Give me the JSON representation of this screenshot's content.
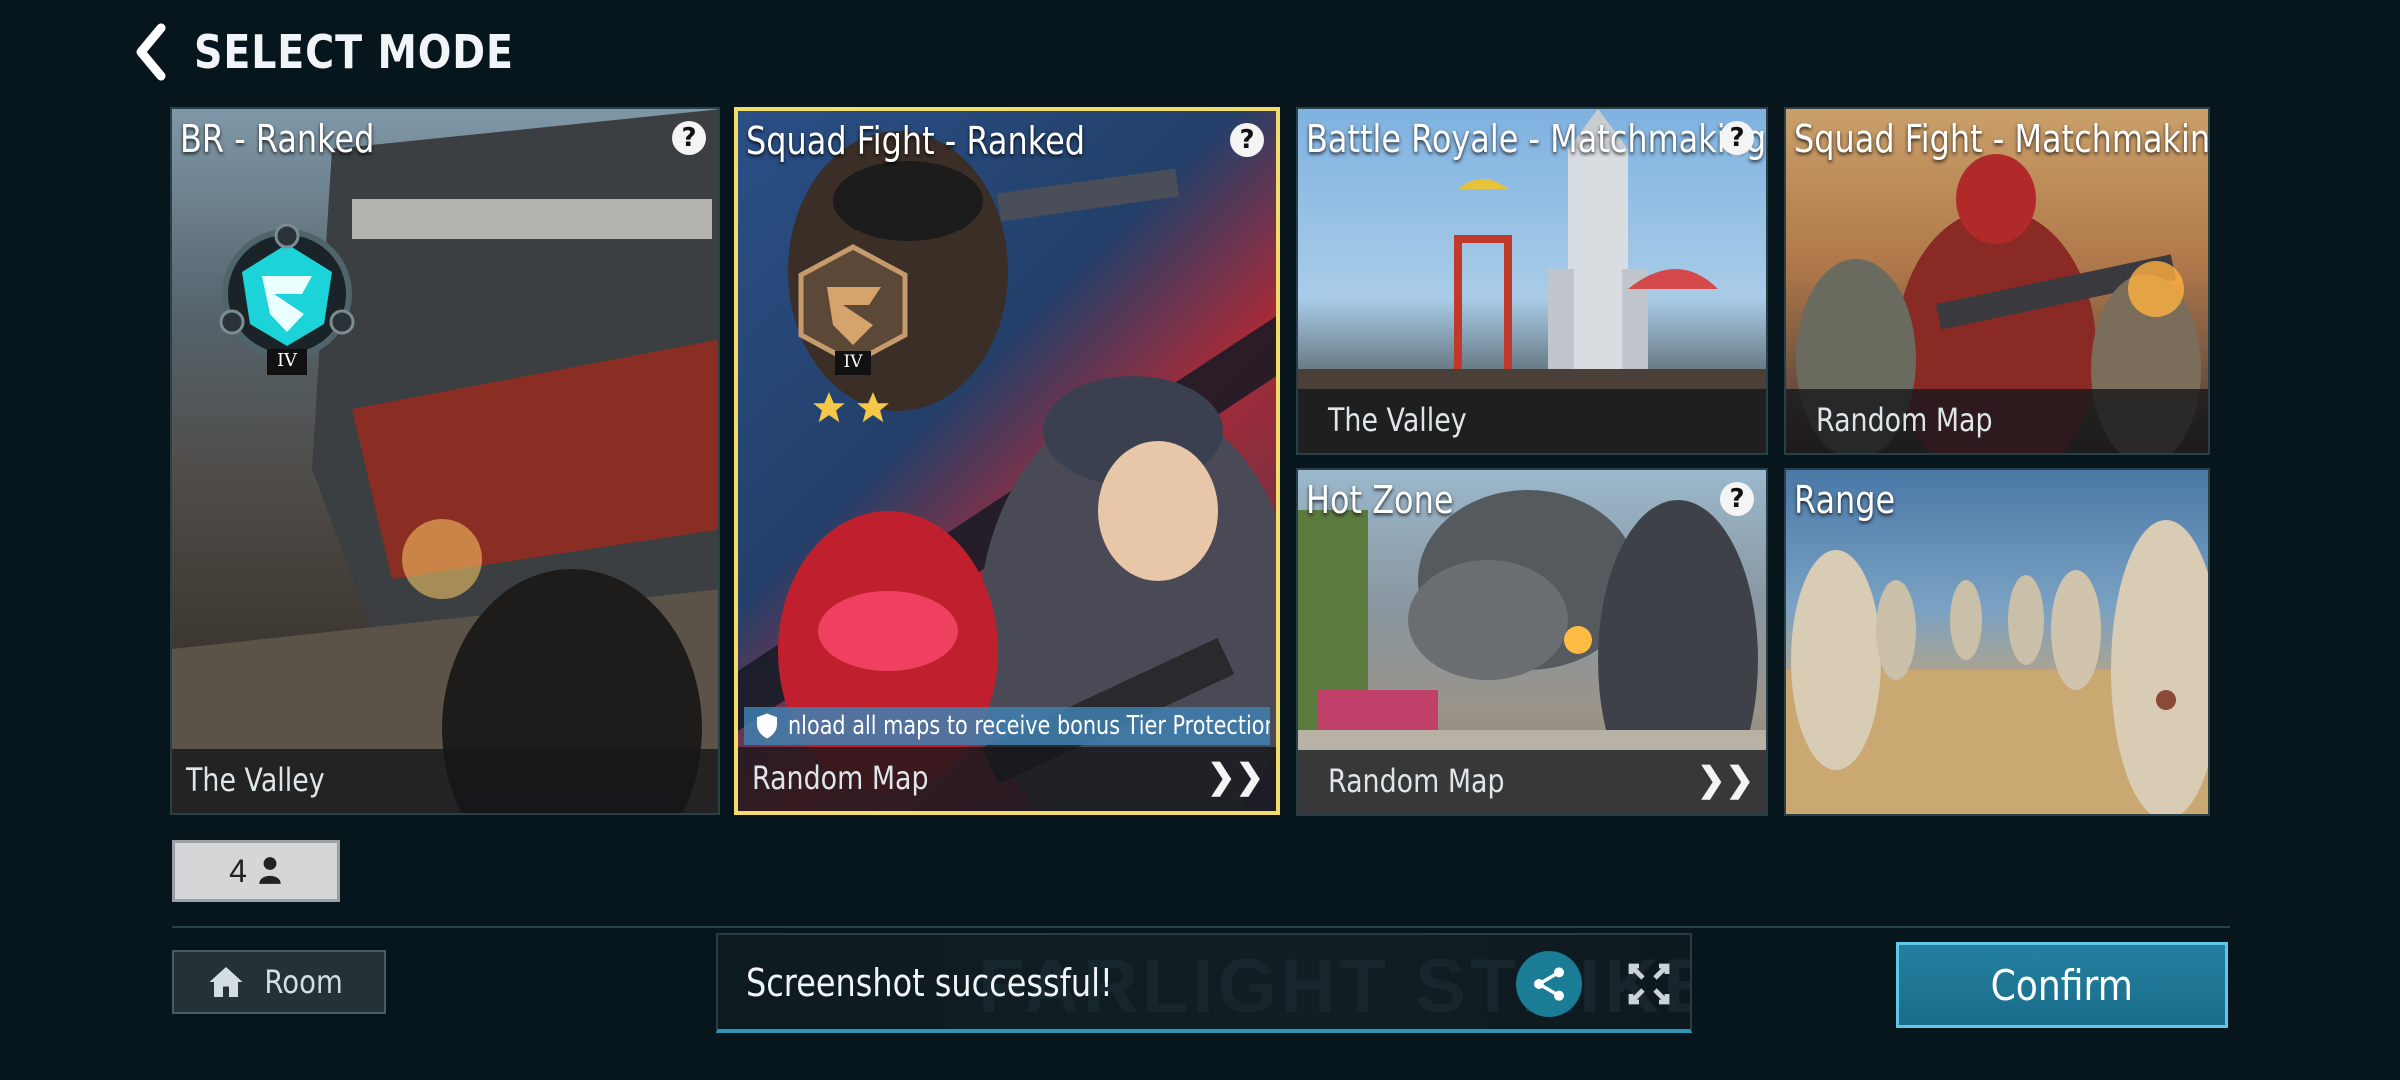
{
  "header": {
    "title": "SELECT MODE",
    "back_icon": "chevron-left-icon"
  },
  "modes": [
    {
      "id": "br-ranked",
      "name": "BR - Ranked",
      "map": "The Valley",
      "has_help": true,
      "rank_tier": "IV",
      "selected": false
    },
    {
      "id": "squad-ranked",
      "name": "Squad Fight - Ranked",
      "map": "Random Map",
      "has_help": true,
      "rank_tier": "IV",
      "stars": 2,
      "notice": "nload all maps to receive bonus Tier Protection Points",
      "selected": true
    },
    {
      "id": "br-matchmaking",
      "name": "Battle Royale - Matchmaking",
      "map": "The Valley",
      "has_help": true,
      "selected": false
    },
    {
      "id": "squad-matchmaking",
      "name": "Squad Fight - Matchmaking",
      "map": "Random Map",
      "has_help": false,
      "selected": false
    },
    {
      "id": "hot-zone",
      "name": "Hot Zone",
      "map": "Random Map",
      "has_help": true,
      "selected": false
    },
    {
      "id": "range",
      "name": "Range",
      "has_help": false,
      "selected": false
    }
  ],
  "help_symbol": "?",
  "chevron_symbol": "❯❯",
  "party": {
    "count": "4",
    "icon": "person-icon"
  },
  "room": {
    "label": "Room",
    "icon": "home-icon"
  },
  "toast": {
    "message": "Screenshot successful!",
    "watermark": "FARLIGHT STRIKE",
    "share_icon": "share-icon",
    "close_icon": "close-icon"
  },
  "confirm": {
    "label": "Confirm"
  },
  "colors": {
    "background": "#06161c",
    "selected_border": "#f2dc6c",
    "accent": "#1b7c96",
    "confirm": "#2380a0",
    "notice": "#3e80b0"
  }
}
